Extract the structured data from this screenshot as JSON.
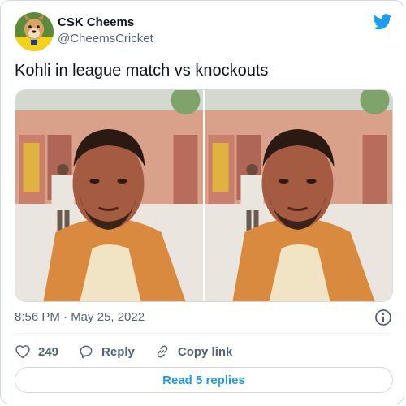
{
  "author": {
    "display_name": "CSK Cheems",
    "handle": "@CheemsCricket",
    "avatar_icon": "cheems-dog-avatar"
  },
  "tweet": {
    "text": "Kohli in league match vs knockouts",
    "timestamp": "8:56 PM · May 25, 2022",
    "images": [
      {
        "name": "photo-left"
      },
      {
        "name": "photo-right"
      }
    ]
  },
  "actions": {
    "like_count": "249",
    "reply_label": "Reply",
    "copy_link_label": "Copy link"
  },
  "replies_button_label": "Read 5 replies",
  "colors": {
    "accent": "#1d9bf0",
    "secondary_text": "#536471",
    "border": "#cfd9de"
  },
  "icons": {
    "brand": "twitter-bird-icon",
    "info": "info-icon",
    "like": "heart-icon",
    "reply": "reply-bubble-icon",
    "copy_link": "link-icon"
  }
}
